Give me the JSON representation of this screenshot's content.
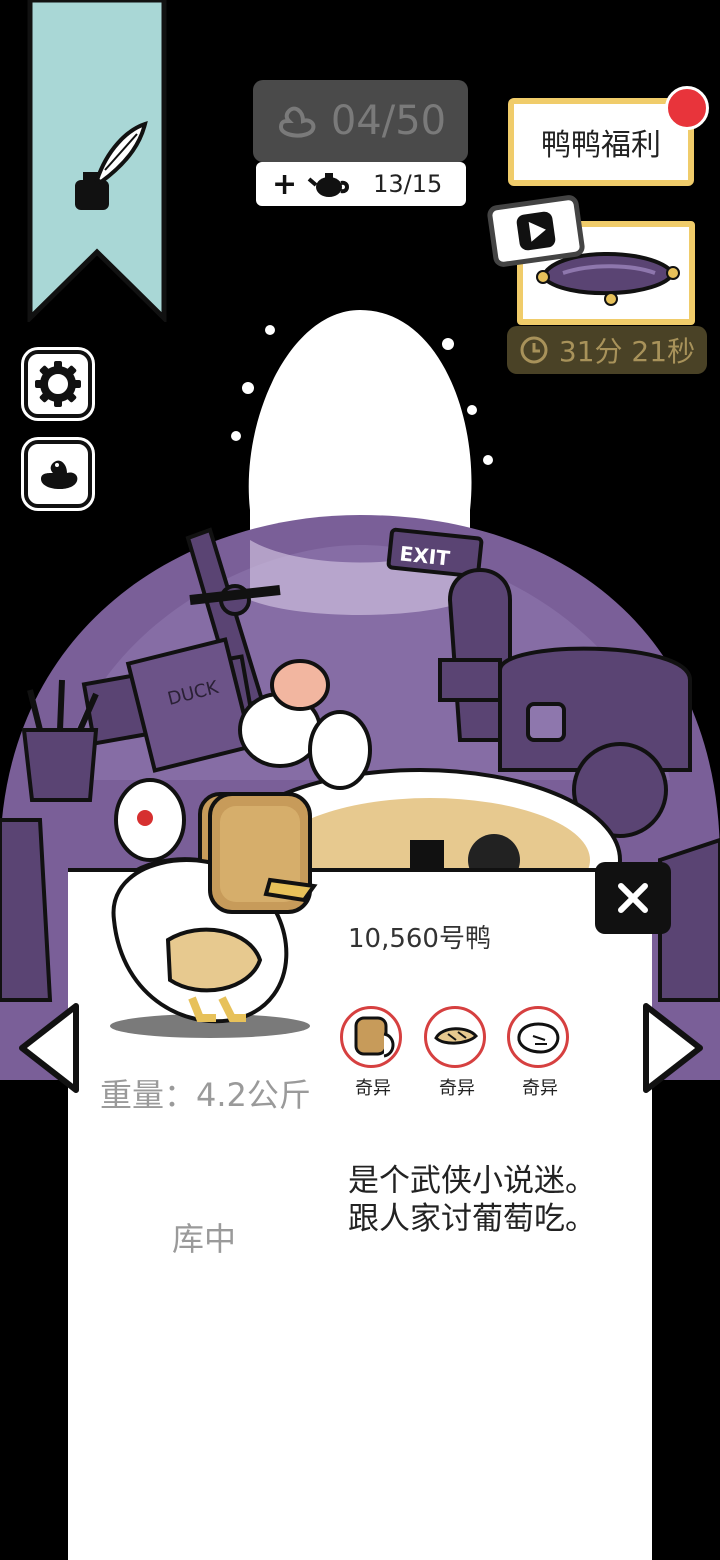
{
  "hud": {
    "duck_count": "04/50",
    "pot_count": "13/15",
    "welfare_label": "鸭鸭福利",
    "timer": "31分 21秒"
  },
  "scene": {
    "exit_sign": "EXIT",
    "book_label": "DUCK"
  },
  "panel": {
    "duck_id": "10,560号鸭",
    "traits": [
      {
        "label": "奇异",
        "icon": "bread-mask-icon"
      },
      {
        "label": "奇异",
        "icon": "duck-feet-icon"
      },
      {
        "label": "奇异",
        "icon": "white-wing-icon"
      }
    ],
    "weight": "重量：4.2公斤",
    "description_line1": "是个武侠小说迷。",
    "description_line2": "跟人家讨葡萄吃。",
    "status": "库中"
  },
  "colors": {
    "ribbon": "#a9d7d6",
    "welfare_border": "#f0cc6a",
    "badge_red": "#e8343b",
    "purple_dark": "#5a4473",
    "purple_light": "#8e77ad"
  }
}
